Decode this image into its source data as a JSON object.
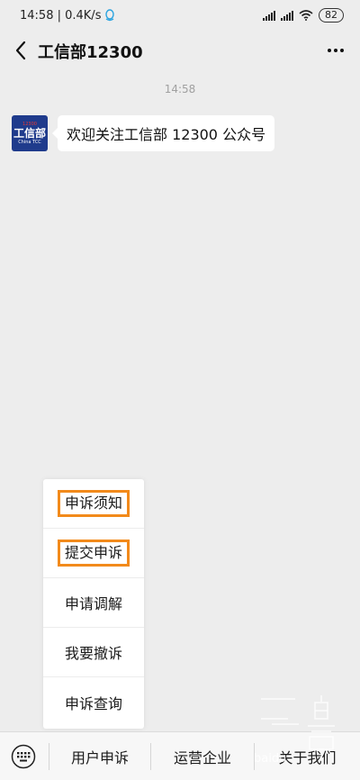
{
  "status_bar": {
    "time_speed": "14:58 | 0.4K/s",
    "battery": "82"
  },
  "header": {
    "title": "工信部12300"
  },
  "chat": {
    "timestamp": "14:58",
    "avatar": {
      "top_text": "12300",
      "main_text": "工信部",
      "sub_text": "China TCC"
    },
    "message": "欢迎关注工信部 12300 公众号"
  },
  "popup_menu": {
    "items": [
      {
        "label": "申诉须知",
        "highlighted": true
      },
      {
        "label": "提交申诉",
        "highlighted": true
      },
      {
        "label": "申请调解",
        "highlighted": false
      },
      {
        "label": "我要撤诉",
        "highlighted": false
      },
      {
        "label": "申诉查询",
        "highlighted": false
      }
    ],
    "highlight_color": "#f28a1b"
  },
  "bottom_menu": {
    "items": [
      "用户申诉",
      "运营企业",
      "关于我们"
    ]
  },
  "watermark": {
    "text": "baidu"
  },
  "colors": {
    "background": "#ededed",
    "avatar_bg": "#1f3b8c"
  }
}
